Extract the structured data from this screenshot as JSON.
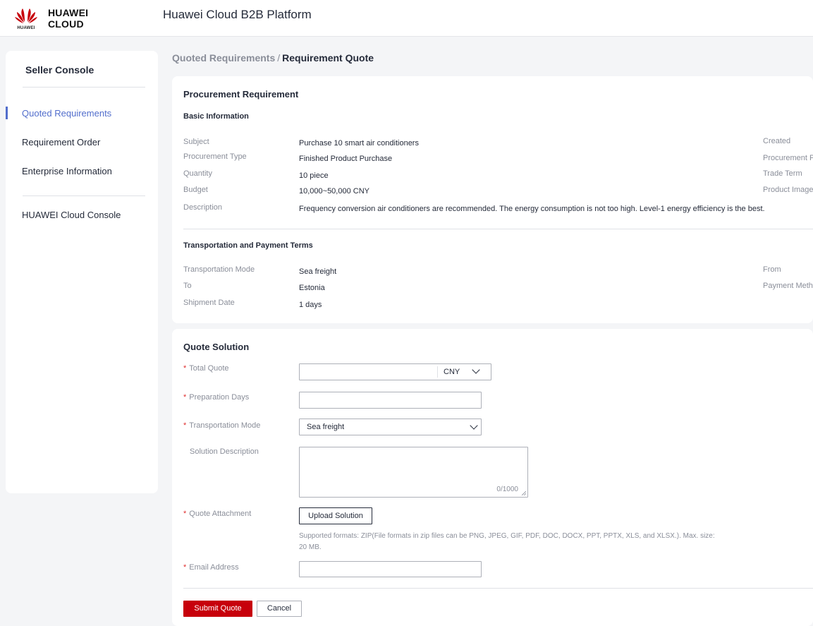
{
  "header": {
    "brand": "HUAWEI CLOUD",
    "logo_sub": "HUAWEI",
    "platform_title": "Huawei Cloud B2B Platform",
    "brand_color": "#c7000b"
  },
  "sidebar": {
    "title": "Seller Console",
    "items": [
      {
        "label": "Quoted Requirements",
        "active": true
      },
      {
        "label": "Requirement Order",
        "active": false
      },
      {
        "label": "Enterprise Information",
        "active": false
      }
    ],
    "console_link": "HUAWEI Cloud Console",
    "accent_color": "#526ecc"
  },
  "breadcrumb": {
    "parent": "Quoted Requirements",
    "separator": "/",
    "current": "Requirement Quote"
  },
  "requirement": {
    "title": "Procurement Requirement",
    "basic": {
      "title": "Basic Information",
      "subject_label": "Subject",
      "subject": "Purchase 10 smart air conditioners",
      "type_label": "Procurement Type",
      "type": "Finished Product Purchase",
      "quantity_label": "Quantity",
      "quantity": "10 piece",
      "budget_label": "Budget",
      "budget": "10,000~50,000 CNY",
      "description_label": "Description",
      "description": "Frequency conversion air conditioners are recommended. The energy consumption is not too high. Level-1 energy efficiency is the best.",
      "created_label": "Created",
      "purpose_label": "Procurement Pu",
      "trade_term_label": "Trade Term",
      "product_image_label": "Product Image"
    },
    "transport": {
      "title": "Transportation and Payment Terms",
      "mode_label": "Transportation Mode",
      "mode": "Sea freight",
      "to_label": "To",
      "to": "Estonia",
      "shipment_label": "Shipment Date",
      "shipment": "1 days",
      "from_label": "From",
      "payment_label": "Payment Metho"
    }
  },
  "quote": {
    "title": "Quote Solution",
    "required_mark": "*",
    "total_quote_label": "Total Quote",
    "total_quote_value": "",
    "currency": "CNY",
    "prep_days_label": "Preparation Days",
    "prep_days_value": "",
    "transport_mode_label": "Transportation Mode",
    "transport_mode_value": "Sea freight",
    "solution_desc_label": "Solution Description",
    "solution_desc_value": "",
    "solution_desc_counter": "0/1000",
    "attachment_label": "Quote Attachment",
    "upload_label": "Upload Solution",
    "attachment_hint": "Supported formats: ZIP(File formats in zip files can be PNG, JPEG, GIF, PDF, DOC, DOCX, PPT, PPTX, XLS, and XLSX.). Max. size: 20 MB.",
    "email_label": "Email Address",
    "email_value": "",
    "submit_label": "Submit Quote",
    "cancel_label": "Cancel"
  }
}
